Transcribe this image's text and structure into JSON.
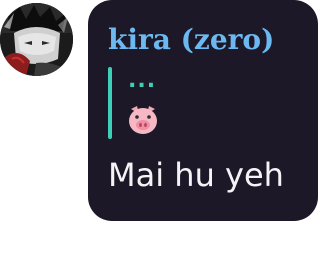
{
  "message": {
    "sender_name": "kira (zero)",
    "reply": {
      "author": "...",
      "preview_icon": "pig-face-icon"
    },
    "text": "Mai hu yeh"
  },
  "colors": {
    "bubble_bg": "#1c1827",
    "sender_name": "#6cb8f0",
    "reply_accent": "#3ecfb9",
    "message_text": "#f4f4f6"
  }
}
